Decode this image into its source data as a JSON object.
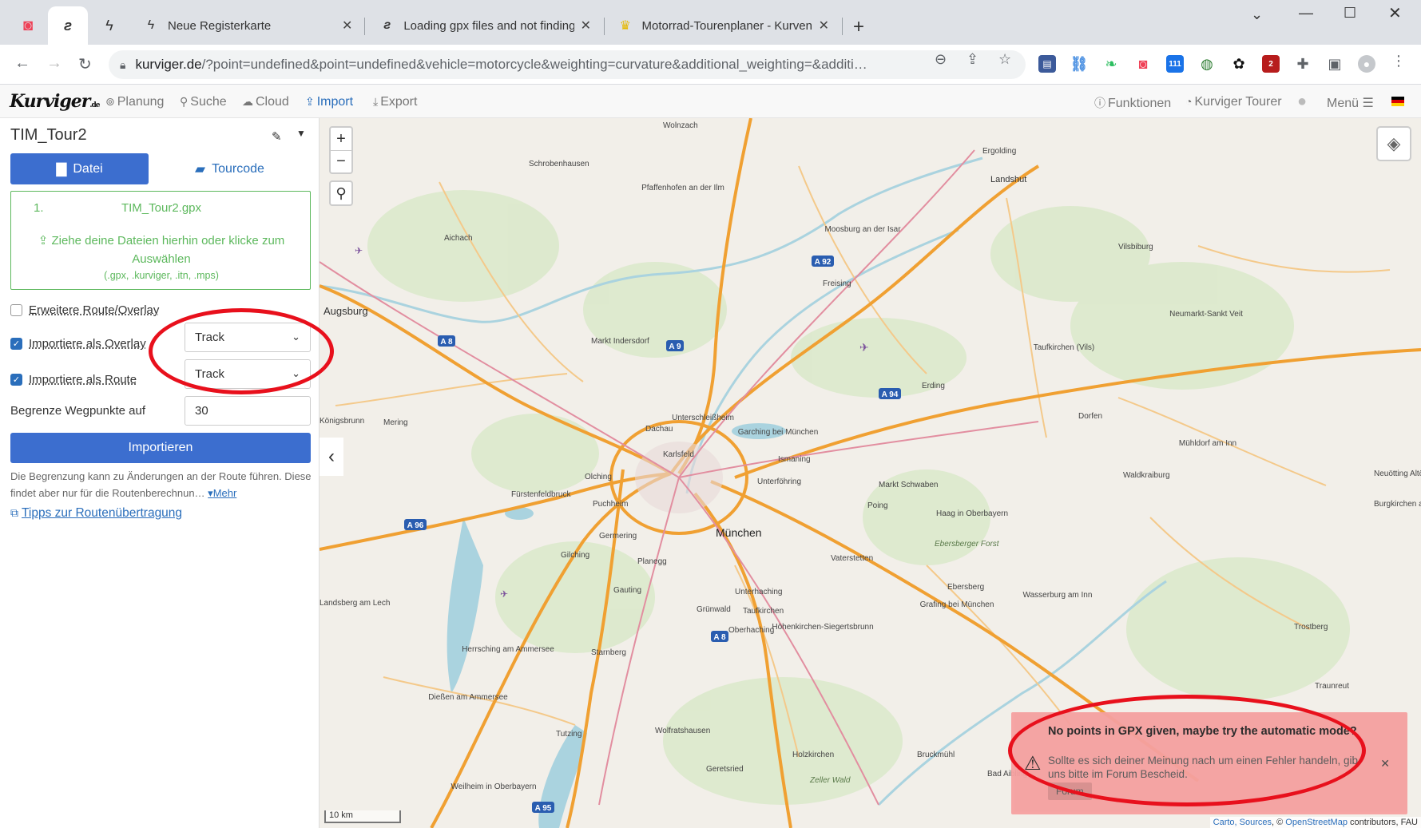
{
  "browser": {
    "tabs": [
      {
        "title": "Neue Registerkarte",
        "icon": "lightning-icon"
      },
      {
        "title": "Loading gpx files and not finding",
        "icon": "kurviger-icon"
      },
      {
        "title": "Motorrad-Tourenplaner - Kurvenr",
        "icon": "crown-icon"
      }
    ],
    "url_host": "kurviger.de",
    "url_rest": "/?point=undefined&point=undefined&vehicle=motorcycle&weighting=curvature&additional_weighting=&additi…",
    "extension_badges": {
      "calendar": "111",
      "shield": "2"
    }
  },
  "app": {
    "logo": "Kurviger",
    "logo_suffix": ".de",
    "nav": {
      "planung": "Planung",
      "suche": "Suche",
      "cloud": "Cloud",
      "import": "Import",
      "export": "Export",
      "funktionen": "Funktionen",
      "tourer": "Kurviger Tourer",
      "menu": "Menü"
    }
  },
  "panel": {
    "tour_title": "TIM_Tour2",
    "tab_datei": "Datei",
    "tab_tourcode": "Tourcode",
    "file_index": "1.",
    "file_name": "TIM_Tour2.gpx",
    "drop_hint": "Ziehe deine Dateien hierhin oder klicke zum Auswählen",
    "drop_ext": "(.gpx, .kurviger, .itn, .mps)",
    "extended_route_label": "Erweitere Route/Overlay",
    "extended_route_checked": false,
    "overlay_label": "Importiere als Overlay",
    "overlay_checked": true,
    "overlay_value": "Track",
    "route_label": "Importiere als Route",
    "route_checked": true,
    "route_value": "Track",
    "limit_label": "Begrenze Wegpunkte auf",
    "limit_value": "30",
    "import_button": "Importieren",
    "note": "Die Begrenzung kann zu Änderungen an der Route führen. Diese findet aber nur für die Routenberechnun…",
    "more_link": "Mehr",
    "tips_link": "Tipps zur Routenübertragung"
  },
  "map": {
    "places": [
      {
        "name": "Wolnzach"
      },
      {
        "name": "Schrobenhausen"
      },
      {
        "name": "Pfaffenhofen an der Ilm"
      },
      {
        "name": "Ergolding"
      },
      {
        "name": "Landshut"
      },
      {
        "name": "Aichach"
      },
      {
        "name": "Moosburg an der Isar"
      },
      {
        "name": "Vilsbiburg"
      },
      {
        "name": "Freising"
      },
      {
        "name": "Augsburg"
      },
      {
        "name": "Markt Indersdorf"
      },
      {
        "name": "Neumarkt-Sankt Veit"
      },
      {
        "name": "Taufkirchen (Vils)"
      },
      {
        "name": "Erding"
      },
      {
        "name": "Dachau"
      },
      {
        "name": "Unterschleißheim"
      },
      {
        "name": "Garching bei München"
      },
      {
        "name": "Dorfen"
      },
      {
        "name": "Königsbrunn"
      },
      {
        "name": "Mering"
      },
      {
        "name": "Ismaning"
      },
      {
        "name": "Karlsfeld"
      },
      {
        "name": "Olching"
      },
      {
        "name": "Unterföhring"
      },
      {
        "name": "Markt Schwaben"
      },
      {
        "name": "Mühldorf am Inn"
      },
      {
        "name": "Fürstenfeldbruck"
      },
      {
        "name": "Puchheim"
      },
      {
        "name": "Poing"
      },
      {
        "name": "Haag in Oberbayern"
      },
      {
        "name": "Waldkraiburg"
      },
      {
        "name": "Germering"
      },
      {
        "name": "München"
      },
      {
        "name": "Vaterstetten"
      },
      {
        "name": "Gilching"
      },
      {
        "name": "Planegg"
      },
      {
        "name": "Ebersberger Forst"
      },
      {
        "name": "Gauting"
      },
      {
        "name": "Unterhaching"
      },
      {
        "name": "Ebersberg"
      },
      {
        "name": "Grafing bei München"
      },
      {
        "name": "Wasserburg am Inn"
      },
      {
        "name": "Grünwald"
      },
      {
        "name": "Taufkirchen"
      },
      {
        "name": "Oberhaching"
      },
      {
        "name": "Höhenkirchen-Siegertsbrunn"
      },
      {
        "name": "Landsberg am Lech"
      },
      {
        "name": "Herrsching am Ammersee"
      },
      {
        "name": "Starnberg"
      },
      {
        "name": "Trostberg"
      },
      {
        "name": "Dießen am Ammersee"
      },
      {
        "name": "Wolfratshausen"
      },
      {
        "name": "Tutzing"
      },
      {
        "name": "Holzkirchen"
      },
      {
        "name": "Bruckmühl"
      },
      {
        "name": "Bad Aibling"
      },
      {
        "name": "Geretsried"
      },
      {
        "name": "Zeller Wald"
      },
      {
        "name": "Weilheim in Oberbayern"
      },
      {
        "name": "Traunreut"
      },
      {
        "name": "Neuötting Altötting"
      },
      {
        "name": "Burgkirchen an der Alz"
      }
    ],
    "road_shields": [
      "A 92",
      "A 8",
      "A 9",
      "A 94",
      "A 96",
      "A 8",
      "A 95"
    ],
    "scale": "10 km",
    "attribution_prefix": "Carto, Sources",
    "attribution_link": "OpenStreetMap",
    "attribution_suffix": "contributors, FAU"
  },
  "toast": {
    "title": "No points in GPX given, maybe try the automatic mode?",
    "text": "Sollte es sich deiner Meinung nach um einen Fehler handeln, gib uns bitte im Forum Bescheid.",
    "button": "Forum"
  }
}
